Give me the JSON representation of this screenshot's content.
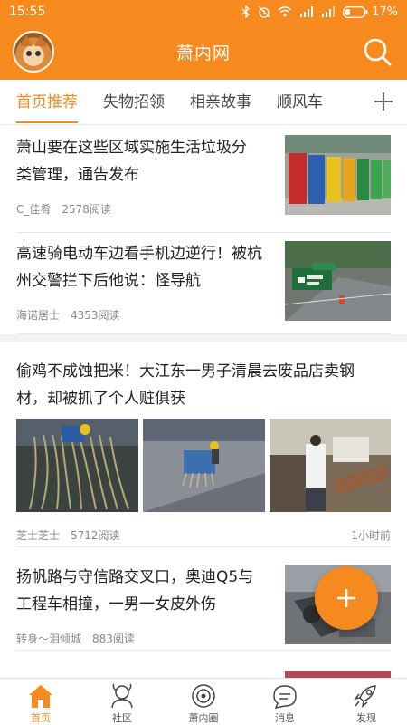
{
  "status_bar": {
    "time": "15:55",
    "battery": "17%"
  },
  "app_bar": {
    "title": "萧内网"
  },
  "tabs": [
    {
      "label": "首页推荐",
      "active": true
    },
    {
      "label": "失物招领",
      "active": false
    },
    {
      "label": "相亲故事",
      "active": false
    },
    {
      "label": "顺风车",
      "active": false
    }
  ],
  "feed": [
    {
      "title_line1": "萧山要在这些区域实施生活垃圾分",
      "title_line2": "类管理，通告发布",
      "author": "C_佳肴",
      "reads": "2578阅读"
    },
    {
      "title_line1": "高速骑电动车边看手机边逆行！被杭",
      "title_line2": "州交警拦下后他说：怪导航",
      "author": "海诺居士",
      "reads": "4353阅读"
    },
    {
      "title_line1": "偷鸡不成蚀把米！大江东一男子清晨去废品店卖钢",
      "title_line2": "材，却被抓了个人赃俱获",
      "author": "芝士芝士",
      "reads": "5712阅读",
      "time": "1小时前"
    },
    {
      "title_line1": "扬帆路与守信路交叉口，奥迪Q5与",
      "title_line2": "工程车相撞，一男一女皮外伤",
      "author": "转身～泪倾城",
      "reads": "883阅读"
    }
  ],
  "bottom_nav": [
    {
      "label": "首页",
      "icon": "home-icon",
      "active": true
    },
    {
      "label": "社区",
      "icon": "community-icon",
      "active": false
    },
    {
      "label": "萧内圈",
      "icon": "circle-icon",
      "active": false
    },
    {
      "label": "消息",
      "icon": "message-icon",
      "active": false
    },
    {
      "label": "发现",
      "icon": "rocket-icon",
      "active": false
    }
  ],
  "colors": {
    "accent": "#f68a1e"
  }
}
